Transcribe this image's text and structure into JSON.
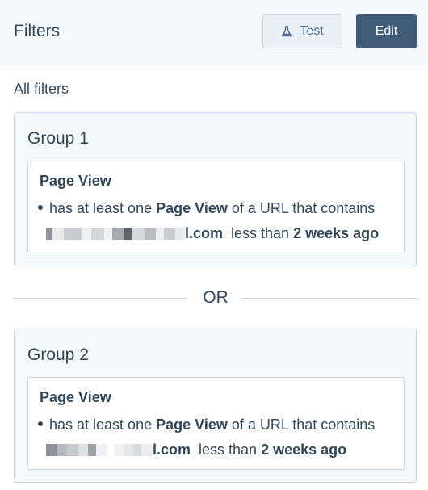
{
  "header": {
    "title": "Filters",
    "test_label": "Test",
    "edit_label": "Edit"
  },
  "all_filters_label": "All filters",
  "or_label": "OR",
  "groups": [
    {
      "title": "Group 1",
      "filter": {
        "title": "Page View",
        "prefix": "has at least one",
        "event": "Page View",
        "middle": "of a URL that contains",
        "url_suffix": "l.com",
        "relation": "less than",
        "timeframe": "2 weeks ago"
      }
    },
    {
      "title": "Group 2",
      "filter": {
        "title": "Page View",
        "prefix": "has at least one",
        "event": "Page View",
        "middle": "of a URL that contains",
        "url_suffix": "l.com",
        "relation": "less than",
        "timeframe": "2 weeks ago"
      }
    }
  ],
  "icons": {
    "test_icon": "flask-icon"
  },
  "colors": {
    "text": "#33475b",
    "header_bg": "#f5f8fa",
    "edit_button_bg": "#425b76",
    "test_button_bg": "#eaf0f6",
    "border": "#cbd6e2"
  }
}
